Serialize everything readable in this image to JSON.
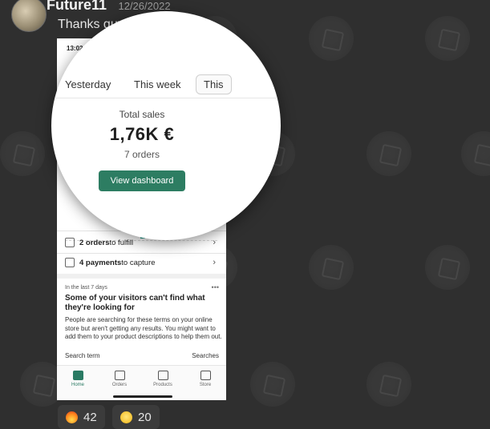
{
  "message": {
    "username": "Future11",
    "timestamp": "12/26/2022",
    "text": "Thanks guys for everything"
  },
  "screenshot": {
    "status_time": "13:02",
    "tabs": [
      "Yesterday",
      "This week",
      "This"
    ],
    "total_sales_label": "Total sales",
    "total_sales_value": "1,76K €",
    "orders_label": "7 orders",
    "dashboard_button": "View dashboard",
    "tasks": [
      {
        "count": "2 orders",
        "text": " to fulfill"
      },
      {
        "count": "4 payments",
        "text": " to capture"
      }
    ],
    "insight": {
      "period": "In the last 7 days",
      "more": "•••",
      "headline": "Some of your visitors can't find what they're looking for",
      "body": "People are searching for these terms on your online store but aren't getting any results. You might want to add them to your product descriptions to help them out.",
      "col_left": "Search term",
      "col_right": "Searches"
    },
    "tabbar": [
      "Home",
      "Orders",
      "Products",
      "Store"
    ]
  },
  "reactions": [
    {
      "emoji": "fire",
      "count": "42"
    },
    {
      "emoji": "grinning-face",
      "count": "20"
    }
  ]
}
